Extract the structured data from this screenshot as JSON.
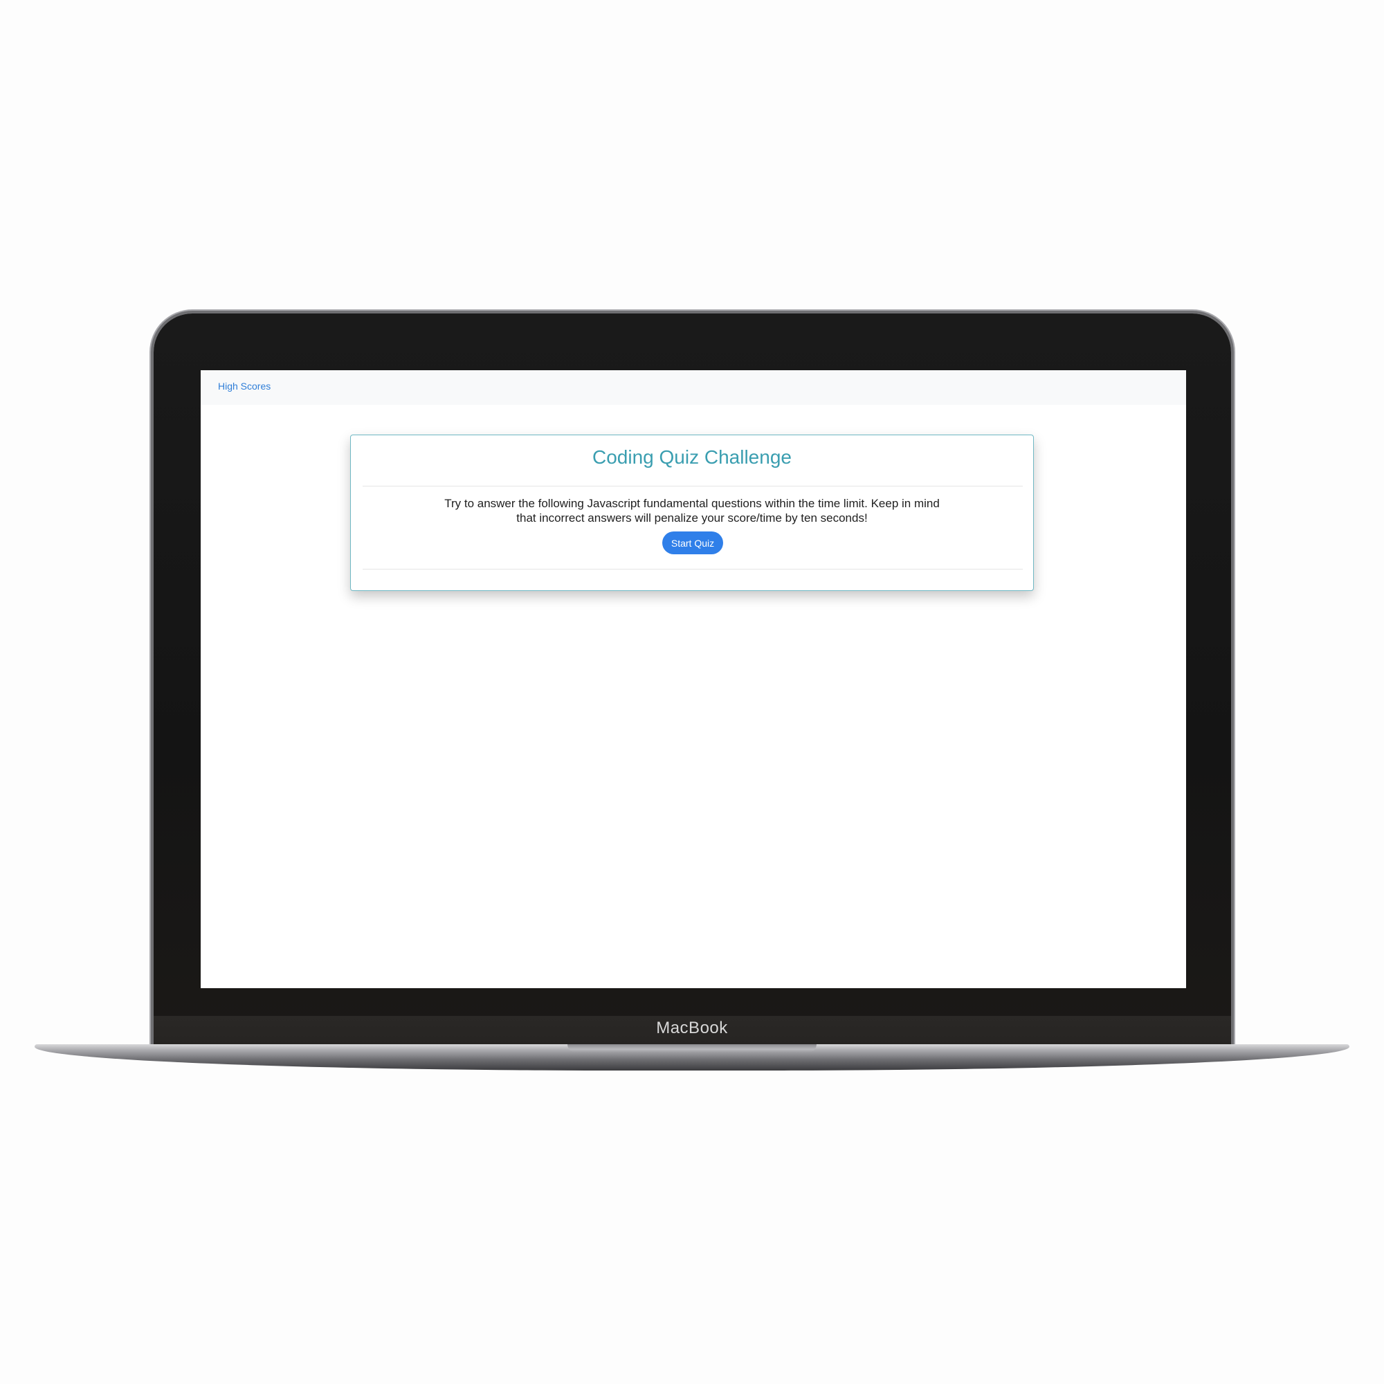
{
  "device": {
    "brand_label": "MacBook"
  },
  "navbar": {
    "high_scores_link": "High Scores"
  },
  "quiz_card": {
    "title": "Coding Quiz Challenge",
    "instructions_line1": "Try to answer the following Javascript fundamental questions within the time limit. Keep in mind",
    "instructions_line2": "that incorrect answers will penalize your score/time by ten seconds!",
    "start_button_label": "Start Quiz"
  },
  "colors": {
    "title_teal": "#3a9eb0",
    "link_blue": "#2f7ed8",
    "button_blue": "#2f7fe9",
    "navbar_bg": "#f8f9fa",
    "card_border": "#6fb8c4"
  }
}
